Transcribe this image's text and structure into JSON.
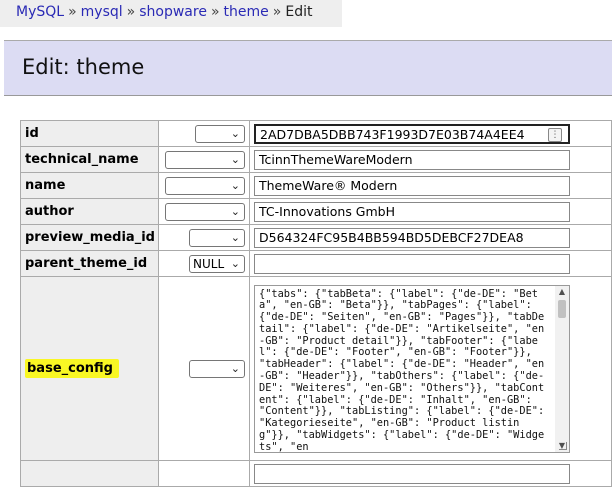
{
  "breadcrumb": {
    "items": [
      "MySQL",
      "mysql",
      "shopware",
      "theme"
    ],
    "separator": "»",
    "current": "Edit"
  },
  "page_title": "Edit: theme",
  "rows": [
    {
      "field": "id",
      "func": "",
      "value": "2AD7DBA5DBB743F1993D7E03B74A4EE4"
    },
    {
      "field": "technical_name",
      "func": "",
      "value": "TcinnThemeWareModern"
    },
    {
      "field": "name",
      "func": "",
      "value": "ThemeWare® Modern"
    },
    {
      "field": "author",
      "func": "",
      "value": "TC-Innovations GmbH"
    },
    {
      "field": "preview_media_id",
      "func": "",
      "value": "D564324FC95B4BB594BD5DEBCF27DEA8"
    },
    {
      "field": "parent_theme_id",
      "func": "NULL",
      "value": ""
    },
    {
      "field": "base_config",
      "func": "",
      "value": "{\"tabs\": {\"tabBeta\": {\"label\": {\"de-DE\": \"Beta\", \"en-GB\": \"Beta\"}}, \"tabPages\": {\"label\": {\"de-DE\": \"Seiten\", \"en-GB\": \"Pages\"}}, \"tabDetail\": {\"label\": {\"de-DE\": \"Artikelseite\", \"en-GB\": \"Product detail\"}}, \"tabFooter\": {\"label\": {\"de-DE\": \"Footer\", \"en-GB\": \"Footer\"}}, \"tabHeader\": {\"label\": {\"de-DE\": \"Header\", \"en-GB\": \"Header\"}}, \"tabOthers\": {\"label\": {\"de-DE\": \"Weiteres\", \"en-GB\": \"Others\"}}, \"tabContent\": {\"label\": {\"de-DE\": \"Inhalt\", \"en-GB\": \"Content\"}}, \"tabListing\": {\"label\": {\"de-DE\": \"Kategorieseite\", \"en-GB\": \"Product listing\"}}, \"tabWidgets\": {\"label\": {\"de-DE\": \"Widgets\", \"en"
    }
  ],
  "colors": {
    "highlight": "#f9f724",
    "link": "#2a2ab5",
    "title_bg": "#dcdcf3"
  }
}
